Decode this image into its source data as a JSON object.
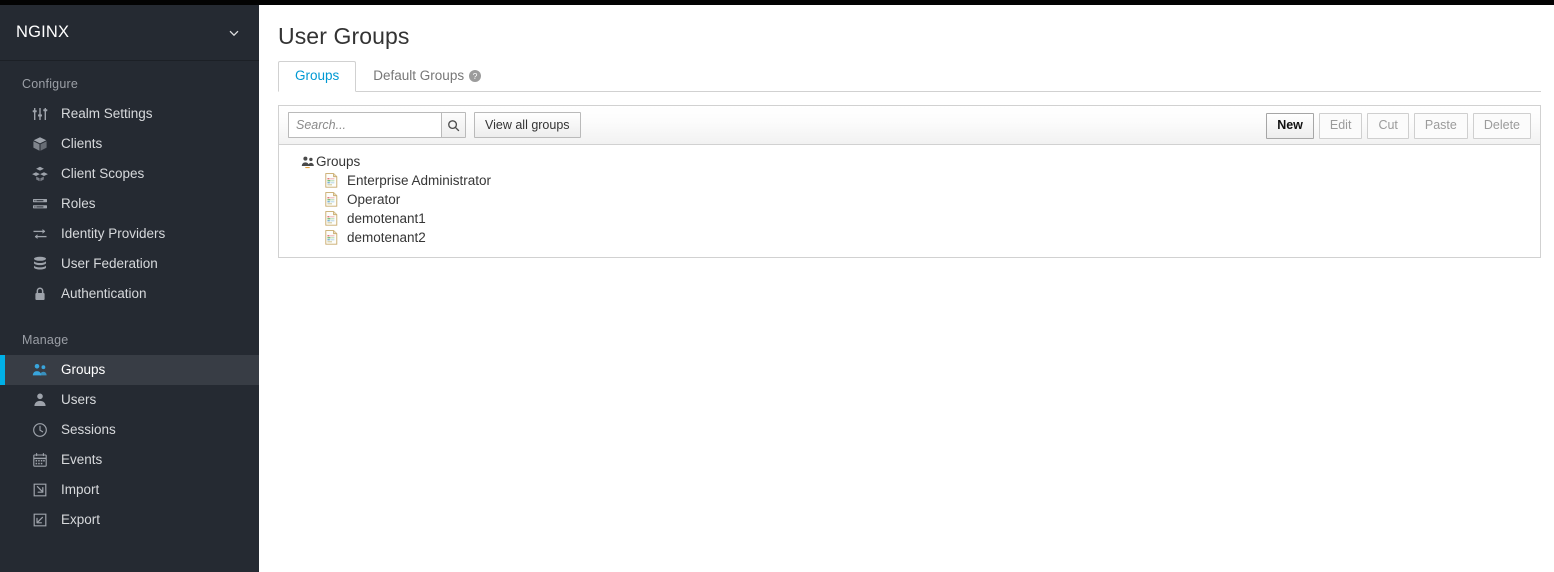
{
  "theme": {
    "sidebar_bg": "#252a32",
    "sidebar_active_bg": "#383d45",
    "accent_blue": "#00b0e6",
    "tab_active_color": "#0099d3",
    "panel_border": "#d1d1d1"
  },
  "sidebar": {
    "realm": {
      "name": "NGINX",
      "chevron_icon": "chevron-down-icon"
    },
    "sections": [
      {
        "label": "Configure",
        "items": [
          {
            "label": "Realm Settings",
            "icon": "sliders-icon",
            "active": false
          },
          {
            "label": "Clients",
            "icon": "cube-icon",
            "active": false
          },
          {
            "label": "Client Scopes",
            "icon": "cubes-icon",
            "active": false
          },
          {
            "label": "Roles",
            "icon": "list-bars-icon",
            "active": false
          },
          {
            "label": "Identity Providers",
            "icon": "exchange-arrows-icon",
            "active": false
          },
          {
            "label": "User Federation",
            "icon": "database-icon",
            "active": false
          },
          {
            "label": "Authentication",
            "icon": "lock-icon",
            "active": false
          }
        ]
      },
      {
        "label": "Manage",
        "items": [
          {
            "label": "Groups",
            "icon": "users-group-icon",
            "active": true
          },
          {
            "label": "Users",
            "icon": "user-icon",
            "active": false
          },
          {
            "label": "Sessions",
            "icon": "clock-icon",
            "active": false
          },
          {
            "label": "Events",
            "icon": "calendar-icon",
            "active": false
          },
          {
            "label": "Import",
            "icon": "import-arrow-icon",
            "active": false
          },
          {
            "label": "Export",
            "icon": "export-arrow-icon",
            "active": false
          }
        ]
      }
    ]
  },
  "main": {
    "page_title": "User Groups",
    "tabs": [
      {
        "label": "Groups",
        "active": true,
        "help_icon": null
      },
      {
        "label": "Default Groups",
        "active": false,
        "help_icon": "help-circle-icon"
      }
    ],
    "toolbar": {
      "search_placeholder": "Search...",
      "search_value": "",
      "search_icon": "magnifier-icon",
      "view_all_label": "View all groups",
      "actions": [
        {
          "label": "New",
          "disabled": false
        },
        {
          "label": "Edit",
          "disabled": true
        },
        {
          "label": "Cut",
          "disabled": true
        },
        {
          "label": "Paste",
          "disabled": true
        },
        {
          "label": "Delete",
          "disabled": true
        }
      ]
    },
    "tree": {
      "root": {
        "label": "Groups",
        "icon": "users-group-icon"
      },
      "children": [
        {
          "label": "Enterprise Administrator",
          "icon": "group-file-icon"
        },
        {
          "label": "Operator",
          "icon": "group-file-icon"
        },
        {
          "label": "demotenant1",
          "icon": "group-file-icon"
        },
        {
          "label": "demotenant2",
          "icon": "group-file-icon"
        }
      ]
    }
  }
}
